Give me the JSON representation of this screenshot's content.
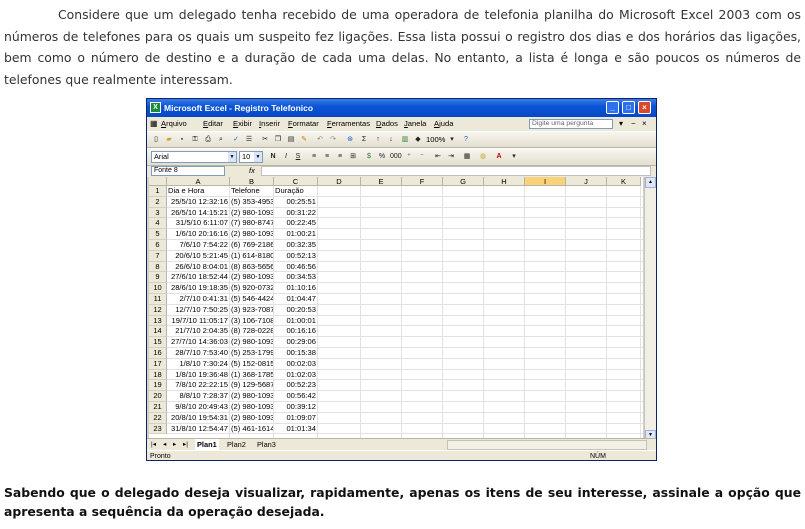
{
  "question": {
    "intro": "Considere que um delegado tenha recebido de uma operadora de telefonia planilha do Microsoft Excel 2003 com os números de telefones para os quais um suspeito fez ligações. Essa lista possui o registro dos dias e dos horários das ligações, bem como o número de destino e a duração de cada uma delas. No entanto, a lista é longa e são poucos os números de telefones que realmente interessam.",
    "prompt": "Sabendo que o delegado deseja visualizar, rapidamente, apenas os itens de seu interesse, assinale a opção que apresenta a sequência da operação desejada."
  },
  "excel": {
    "title": "Microsoft Excel - Registro Telefonico",
    "menu": [
      "Arquivo",
      "Editar",
      "Exibir",
      "Inserir",
      "Formatar",
      "Ferramentas",
      "Dados",
      "Janela",
      "Ajuda"
    ],
    "ask_placeholder": "Digite uma pergunta",
    "zoom": "100%",
    "font_name": "Arial",
    "font_size": "10",
    "name_box": "Fonte 8",
    "fx_label": "fx",
    "columns": [
      "A",
      "B",
      "C",
      "D",
      "E",
      "F",
      "G",
      "H",
      "I",
      "J",
      "K"
    ],
    "active_column": "I",
    "headers": [
      "Dia e Hora",
      "Telefone",
      "Duração"
    ],
    "rows": [
      [
        "25/5/10 12:32:16",
        "(5) 353-4953",
        "00:25:51"
      ],
      [
        "26/5/10 14:15:21",
        "(2) 980-1093",
        "00:31:22"
      ],
      [
        "31/5/10 6:11:07",
        "(7) 980-8747",
        "00:22:45"
      ],
      [
        "1/6/10 20:16:16",
        "(2) 980-1093",
        "01:00:21"
      ],
      [
        "7/6/10 7:54:22",
        "(6) 769-2186",
        "00:32:35"
      ],
      [
        "20/6/10 5:21:45",
        "(1) 614-8180",
        "00:52:13"
      ],
      [
        "26/6/10 8:04:01",
        "(8) 863-5656",
        "00:46:56"
      ],
      [
        "27/6/10 18:52:44",
        "(2) 980-1093",
        "00:34:53"
      ],
      [
        "28/6/10 19:18:35",
        "(5) 920-0732",
        "01:10:16"
      ],
      [
        "2/7/10 0:41:31",
        "(5) 546-4424",
        "01:04:47"
      ],
      [
        "12/7/10 7:50:25",
        "(3) 923-7087",
        "00:20:53"
      ],
      [
        "19/7/10 11:05:17",
        "(3) 106-7108",
        "01:00:01"
      ],
      [
        "21/7/10 2:04:35",
        "(8) 728-0228",
        "00:16:16"
      ],
      [
        "27/7/10 14:36:03",
        "(2) 980-1093",
        "00:29:06"
      ],
      [
        "28/7/10 7:53:40",
        "(5) 253-1799",
        "00:15:38"
      ],
      [
        "1/8/10 7:30:24",
        "(5) 152-0815",
        "00:02:03"
      ],
      [
        "1/8/10 19:36:48",
        "(1) 368-1785",
        "01:02:03"
      ],
      [
        "7/8/10 22:22:15",
        "(9) 129-5687",
        "00:52:23"
      ],
      [
        "8/8/10 7:28:37",
        "(2) 980-1093",
        "00:56:42"
      ],
      [
        "9/8/10 20:49:43",
        "(2) 980-1093",
        "00:39:12"
      ],
      [
        "20/8/10 19:54:31",
        "(2) 980-1093",
        "01:09:07"
      ],
      [
        "31/8/10 12:54:47",
        "(5) 461-1614",
        "01:01:34"
      ]
    ],
    "sheet_tabs": [
      "Plan1",
      "Plan2",
      "Plan3"
    ],
    "active_sheet": "Plan1",
    "status": "Pronto",
    "status_num": "NÚM"
  }
}
